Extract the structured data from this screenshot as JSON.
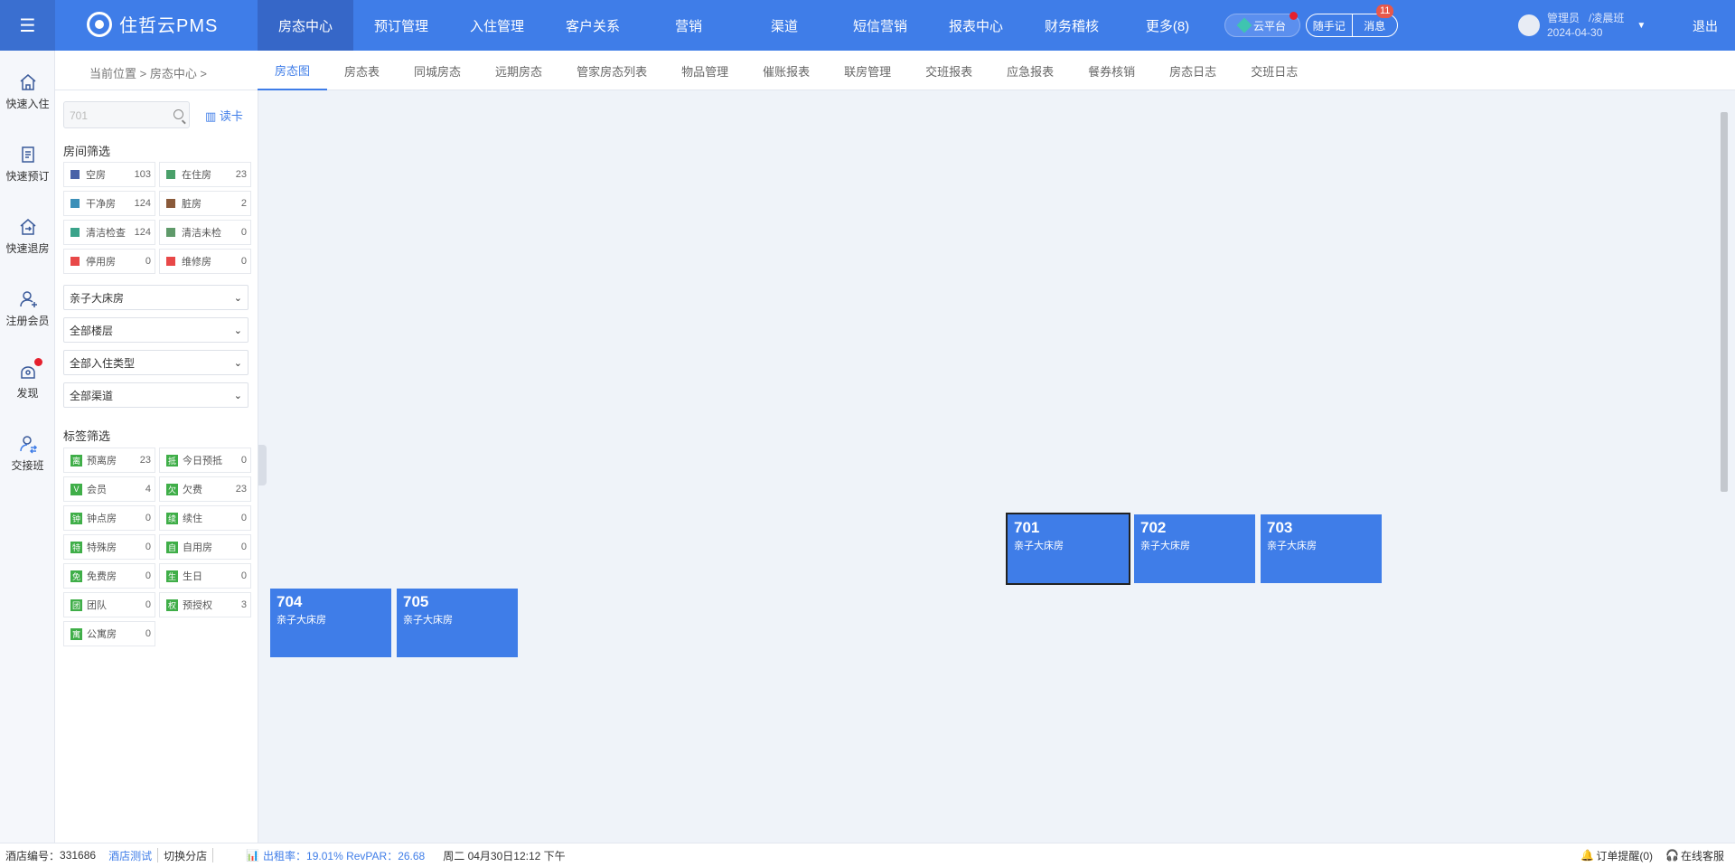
{
  "header": {
    "app_name": "住哲云PMS",
    "nav": [
      "房态中心",
      "预订管理",
      "入住管理",
      "客户关系",
      "营销",
      "渠道",
      "短信营销",
      "报表中心",
      "财务稽核",
      "更多(8)"
    ],
    "cloud_label": "云平台",
    "notes_label": "随手记",
    "messages_label": "消息",
    "messages_badge": "11",
    "user_role": "管理员",
    "user_shift": "/凌晨班",
    "user_date": "2024-04-30",
    "logout_label": "退出"
  },
  "leftbar": [
    {
      "label": "快速入住",
      "icon": "home-icon"
    },
    {
      "label": "快速预订",
      "icon": "booking-icon"
    },
    {
      "label": "快速退房",
      "icon": "checkout-icon"
    },
    {
      "label": "注册会员",
      "icon": "add-member-icon"
    },
    {
      "label": "发现",
      "icon": "discover-icon"
    },
    {
      "label": "交接班",
      "icon": "handover-icon"
    }
  ],
  "breadcrumb": "当前位置 > 房态中心 >",
  "tabs": [
    "房态图",
    "房态表",
    "同城房态",
    "远期房态",
    "管家房态列表",
    "物品管理",
    "催账报表",
    "联房管理",
    "交班报表",
    "应急报表",
    "餐券核销",
    "房态日志",
    "交班日志"
  ],
  "filter": {
    "search_placeholder": "701",
    "read_card": "读卡",
    "room_filter_title": "房间筛选",
    "status_items": [
      {
        "label": "空房",
        "count": "103",
        "color": "#4a63a8"
      },
      {
        "label": "在住房",
        "count": "23",
        "color": "#4aa06a"
      },
      {
        "label": "干净房",
        "count": "124",
        "color": "#3b8fb8"
      },
      {
        "label": "脏房",
        "count": "2",
        "color": "#8a5a3a"
      },
      {
        "label": "清洁检查",
        "count": "124",
        "color": "#3aa38a"
      },
      {
        "label": "清洁未检",
        "count": "0",
        "color": "#5f9a6a"
      },
      {
        "label": "停用房",
        "count": "0",
        "color": "#e84848"
      },
      {
        "label": "维修房",
        "count": "0",
        "color": "#e84848"
      }
    ],
    "selects": [
      "亲子大床房",
      "全部楼层",
      "全部入住类型",
      "全部渠道"
    ],
    "tag_filter_title": "标签筛选",
    "tag_items": [
      {
        "tag": "离",
        "label": "预离房",
        "count": "23"
      },
      {
        "tag": "抵",
        "label": "今日预抵",
        "count": "0"
      },
      {
        "tag": "V",
        "label": "会员",
        "count": "4"
      },
      {
        "tag": "欠",
        "label": "欠费",
        "count": "23"
      },
      {
        "tag": "钟",
        "label": "钟点房",
        "count": "0"
      },
      {
        "tag": "续",
        "label": "续住",
        "count": "0"
      },
      {
        "tag": "特",
        "label": "特殊房",
        "count": "0"
      },
      {
        "tag": "自",
        "label": "自用房",
        "count": "0"
      },
      {
        "tag": "免",
        "label": "免费房",
        "count": "0"
      },
      {
        "tag": "生",
        "label": "生日",
        "count": "0"
      },
      {
        "tag": "团",
        "label": "团队",
        "count": "0"
      },
      {
        "tag": "权",
        "label": "预授权",
        "count": "3"
      },
      {
        "tag": "寓",
        "label": "公寓房",
        "count": "0"
      }
    ]
  },
  "rooms": [
    {
      "no": "701",
      "type": "亲子大床房"
    },
    {
      "no": "702",
      "type": "亲子大床房"
    },
    {
      "no": "703",
      "type": "亲子大床房"
    },
    {
      "no": "704",
      "type": "亲子大床房"
    },
    {
      "no": "705",
      "type": "亲子大床房"
    }
  ],
  "status": {
    "hotel_no_label": "酒店编号：",
    "hotel_no": "331686",
    "hotel_name": "酒店测试",
    "switch": "切换分店",
    "occupancy": "出租率：19.01% RevPAR：26.68",
    "datetime": "周二 04月30日12:12 下午",
    "order_alert": "订单提醒(0)",
    "service": "在线客服"
  }
}
